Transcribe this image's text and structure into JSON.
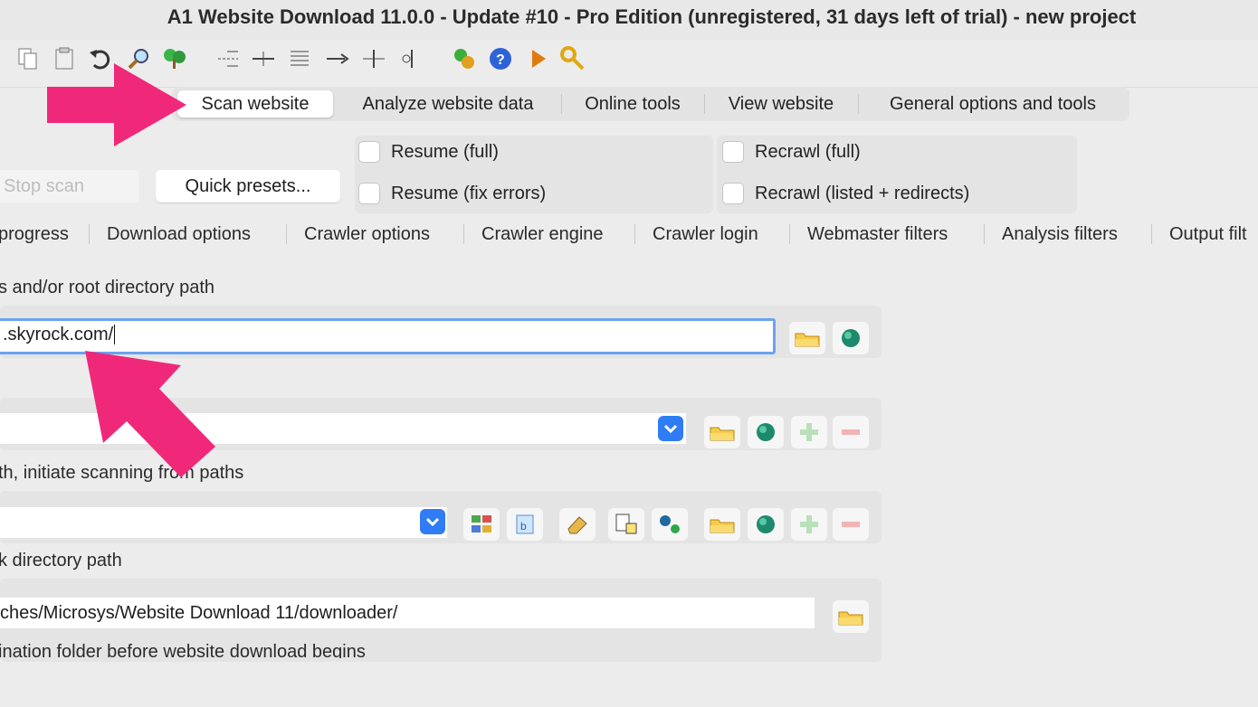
{
  "window": {
    "title": "A1 Website Download 11.0.0 - Update #10 - Pro Edition (unregistered, 31 days left of trial) - new project"
  },
  "main_tabs": [
    {
      "label": "Scan website",
      "active": true
    },
    {
      "label": "Analyze website data"
    },
    {
      "label": "Online tools"
    },
    {
      "label": "View website"
    },
    {
      "label": "General options and tools"
    }
  ],
  "scan_controls": {
    "stop_scan": "Stop scan",
    "quick_presets": "Quick presets...",
    "resume_full": "Resume (full)",
    "resume_fix_errors": "Resume (fix errors)",
    "recrawl_full": "Recrawl (full)",
    "recrawl_listed": "Recrawl (listed + redirects)"
  },
  "sub_tabs": [
    "progress",
    "Download options",
    "Crawler options",
    "Crawler engine",
    "Crawler login",
    "Webmaster filters",
    "Analysis filters",
    "Output filt"
  ],
  "form": {
    "root_label": "s and/or root directory path",
    "root_value": ".skyrock.com/",
    "paths_label": "th, initiate scanning from paths",
    "disk_label": "k directory path",
    "disk_value": "ches/Microsys/Website Download 11/downloader/",
    "note": "ination folder before website download begins"
  },
  "colors": {
    "arrow": "#f0287a",
    "focus": "#6aa3f0",
    "dropdown": "#2f7cf6"
  }
}
